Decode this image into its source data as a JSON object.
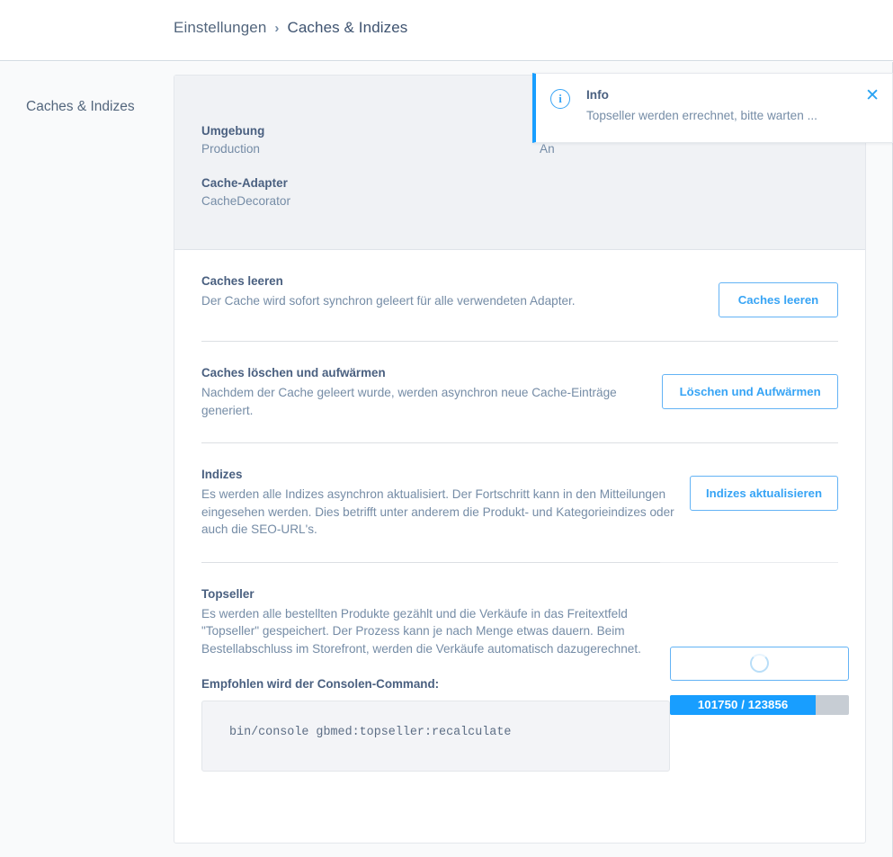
{
  "breadcrumb": {
    "parent": "Einstellungen",
    "separator": "›",
    "current": "Caches & Indizes"
  },
  "page": {
    "section_title": "Caches & Indizes"
  },
  "card_header": {
    "fields": [
      {
        "label": "Umgebung",
        "value": "Production"
      },
      {
        "label": "Cache-Adapter",
        "value": "CacheDecorator"
      }
    ],
    "secondary_value": "An"
  },
  "rows": [
    {
      "title": "Caches leeren",
      "desc": "Der Cache wird sofort synchron geleert für alle verwendeten Adapter.",
      "button": "Caches leeren"
    },
    {
      "title": "Caches löschen und aufwärmen",
      "desc": "Nachdem der Cache geleert wurde, werden asynchron neue Cache-Einträge generiert.",
      "button": "Löschen und Aufwärmen"
    },
    {
      "title": "Indizes",
      "desc": "Es werden alle Indizes asynchron aktualisiert. Der Fortschritt kann in den Mitteilungen eingesehen werden. Dies betrifft unter anderem die Produkt- und Kategorieindizes oder auch die SEO-URL's.",
      "button": "Indizes aktualisieren"
    }
  ],
  "topseller": {
    "title": "Topseller",
    "desc": "Es werden alle bestellten Produkte gezählt und die Verkäufe in das Freitextfeld \"Topseller\" gespeichert. Der Prozess kann je nach Menge etwas dauern. Beim Bestellabschluss im Storefront, werden die Verkäufe automatisch dazugerechnet.",
    "command_label": "Empfohlen wird der Consolen-Command:",
    "command": "bin/console gbmed:topseller:recalculate",
    "progress_label": "101750 / 123856",
    "progress_current": 101750,
    "progress_total": 123856,
    "progress_percent": 81.5,
    "spinner_state": "loading"
  },
  "notification": {
    "icon": "info-circle-icon",
    "icon_glyph": "i",
    "title": "Info",
    "message": "Topseller werden errechnet, bitte warten ...",
    "close_glyph": "✕"
  },
  "colors": {
    "accent": "#189eff",
    "button_border": "#63b3f5",
    "text_primary": "#4a6080",
    "text_secondary": "#758ca6",
    "progress_track": "#c7cdd4"
  }
}
